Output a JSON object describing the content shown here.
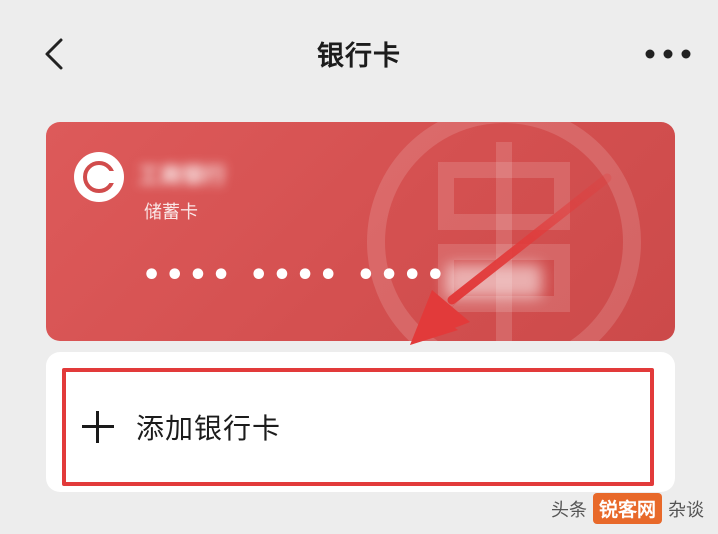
{
  "navbar": {
    "title": "银行卡",
    "back_icon": "chevron-left-icon",
    "more_icon": "ellipsis-icon"
  },
  "card": {
    "bank_name": "工商银行",
    "card_type": "储蓄卡",
    "card_number_masked": "•••• •••• ••••",
    "background_color": "#d45050",
    "logo_icon": "bank-logo-icon"
  },
  "add_card": {
    "label": "添加银行卡",
    "plus_icon": "plus-icon",
    "highlight_color": "#e23a3a"
  },
  "watermark": {
    "prefix": "头条",
    "site": "锐客网",
    "suffix": "杂谈"
  }
}
